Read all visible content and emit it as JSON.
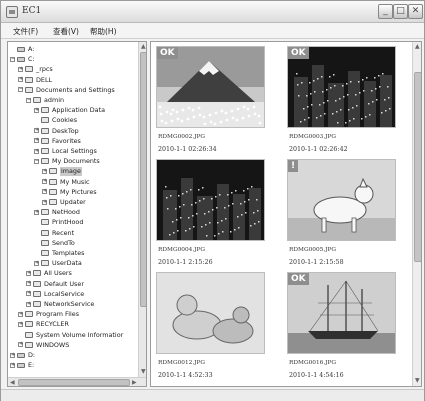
{
  "window": {
    "title": "EC1"
  },
  "menu": [
    {
      "label": "文件(F)"
    },
    {
      "label": "查看(V)"
    },
    {
      "label": "帮助(H)"
    }
  ],
  "tree": [
    {
      "label": "A:",
      "icon": "floppy-drive-icon",
      "expanded": false
    },
    {
      "label": "C:",
      "icon": "drive-icon",
      "expanded": true
    },
    {
      "label": "_rpcs",
      "icon": "folder-icon",
      "expanded": false
    },
    {
      "label": "DELL",
      "icon": "folder-icon",
      "expanded": false
    },
    {
      "label": "Documents and Settings",
      "icon": "folder-icon",
      "expanded": true
    },
    {
      "label": "admin",
      "icon": "folder-icon",
      "expanded": true
    },
    {
      "label": "Application Data",
      "icon": "folder-icon",
      "expanded": false
    },
    {
      "label": "Cookies",
      "icon": "folder-icon",
      "expanded": false
    },
    {
      "label": "DeskTop",
      "icon": "folder-icon",
      "expanded": false
    },
    {
      "label": "Favorites",
      "icon": "star-folder-icon",
      "expanded": false
    },
    {
      "label": "Local Settings",
      "icon": "folder-icon",
      "expanded": false
    },
    {
      "label": "My Documents",
      "icon": "folder-icon",
      "expanded": true
    },
    {
      "label": "image",
      "icon": "folder-icon",
      "expanded": false,
      "selected": true
    },
    {
      "label": "My Music",
      "icon": "music-folder-icon",
      "expanded": false
    },
    {
      "label": "My Pictures",
      "icon": "pictures-folder-icon",
      "expanded": false
    },
    {
      "label": "Updater",
      "icon": "folder-icon",
      "expanded": false
    },
    {
      "label": "NetHood",
      "icon": "folder-icon",
      "expanded": false
    },
    {
      "label": "PrintHood",
      "icon": "folder-icon",
      "expanded": false
    },
    {
      "label": "Recent",
      "icon": "folder-icon",
      "expanded": false
    },
    {
      "label": "SendTo",
      "icon": "folder-icon",
      "expanded": false
    },
    {
      "label": "Templates",
      "icon": "folder-icon",
      "expanded": false
    },
    {
      "label": "UserData",
      "icon": "folder-icon",
      "expanded": false
    },
    {
      "label": "All Users",
      "icon": "folder-icon",
      "expanded": false
    },
    {
      "label": "Default User",
      "icon": "folder-icon",
      "expanded": false
    },
    {
      "label": "LocalService",
      "icon": "folder-icon",
      "expanded": false
    },
    {
      "label": "NetworkService",
      "icon": "folder-icon",
      "expanded": false
    },
    {
      "label": "Program Files",
      "icon": "folder-icon",
      "expanded": false
    },
    {
      "label": "RECYCLER",
      "icon": "folder-icon",
      "expanded": false
    },
    {
      "label": "System Volume Informatior",
      "icon": "folder-icon",
      "expanded": false
    },
    {
      "label": "WINDOWS",
      "icon": "folder-icon",
      "expanded": false
    },
    {
      "label": "D:",
      "icon": "drive-icon",
      "expanded": false
    },
    {
      "label": "E:",
      "icon": "drive-icon",
      "expanded": false
    }
  ],
  "thumbnails": [
    {
      "filename": "RDMG0002.JPG",
      "date": "2010-1-1  02:26:34",
      "badge": "OK",
      "image": "mountain-icon"
    },
    {
      "filename": "RDMG0003.JPG",
      "date": "2010-1-1  02:26:42",
      "badge": "OK",
      "image": "night-city-icon"
    },
    {
      "filename": "RDMG0004.JPG",
      "date": "2010-1-1  2:15:26",
      "badge": "",
      "image": "night-city-icon"
    },
    {
      "filename": "RDMG0005.JPG",
      "date": "2010-1-1  2:15:58",
      "badge": "!",
      "image": "dog-icon"
    },
    {
      "filename": "RDMG0012.JPG",
      "date": "2010-1-1  4:52:33",
      "badge": "",
      "image": "dogs-icon"
    },
    {
      "filename": "RDMG0016.JPG",
      "date": "2010-1-1  4:54:16",
      "badge": "OK",
      "image": "sailing-ship-icon"
    }
  ]
}
